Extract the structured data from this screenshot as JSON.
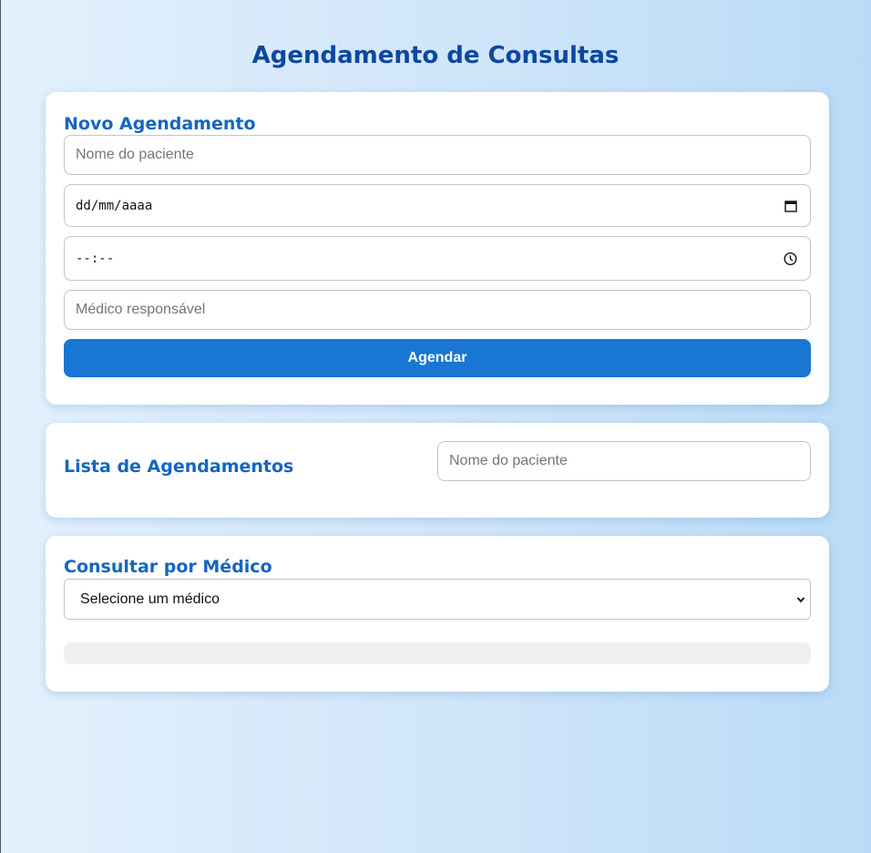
{
  "page": {
    "title": "Agendamento de Consultas"
  },
  "new_appointment": {
    "title": "Novo Agendamento",
    "patient_placeholder": "Nome do paciente",
    "date_placeholder": "dd/mm/aaaa",
    "time_placeholder": "--:--",
    "doctor_placeholder": "Médico responsável",
    "submit_label": "Agendar",
    "icons": [
      "calendar-icon",
      "clock-icon"
    ]
  },
  "appointment_list": {
    "title": "Lista de Agendamentos",
    "search_placeholder": "Nome do paciente"
  },
  "doctor_query": {
    "title": "Consultar por Médico",
    "select_value": "Selecione um médico",
    "icons": [
      "chevron-down-icon"
    ]
  },
  "colors": {
    "accent": "#1976d2",
    "heading": "#0d47a1",
    "section_title": "#1565c0"
  }
}
